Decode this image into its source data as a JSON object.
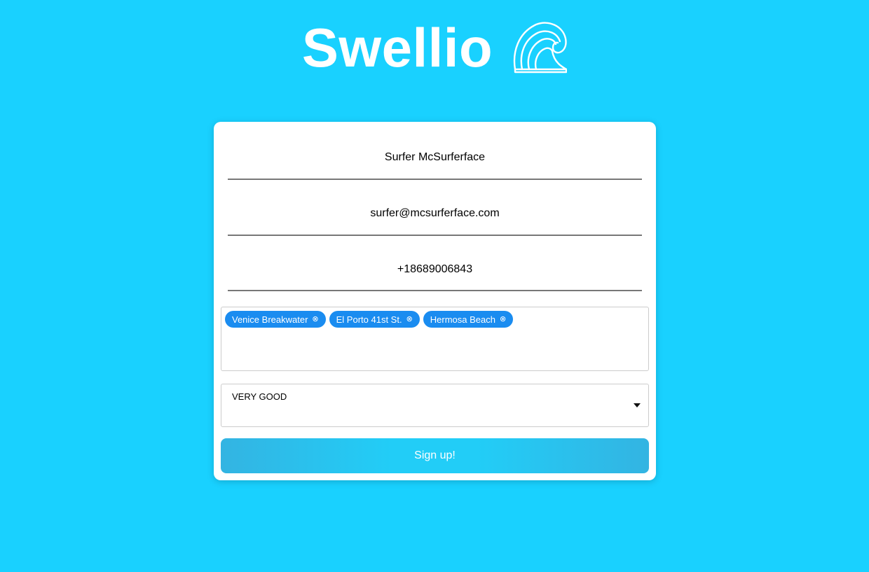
{
  "app": {
    "brand_name": "Swellio",
    "logo_icon": "wave-icon"
  },
  "form": {
    "name_value": "Surfer McSurferface",
    "email_value": "surfer@mcsurferface.com",
    "phone_value": "+18689006843",
    "spots": [
      {
        "label": "Venice Breakwater",
        "remove_icon": "remove-circle-icon",
        "remove_glyph": "⊗"
      },
      {
        "label": "El Porto 41st St.",
        "remove_icon": "remove-circle-icon",
        "remove_glyph": "⊗"
      },
      {
        "label": "Hermosa Beach",
        "remove_icon": "remove-circle-icon",
        "remove_glyph": "⊗"
      }
    ],
    "condition_selected": "VERY GOOD",
    "submit_label": "Sign up!"
  },
  "colors": {
    "background": "#19d1ff",
    "tag": "#1a8cf0",
    "button": "#22cdf7"
  }
}
